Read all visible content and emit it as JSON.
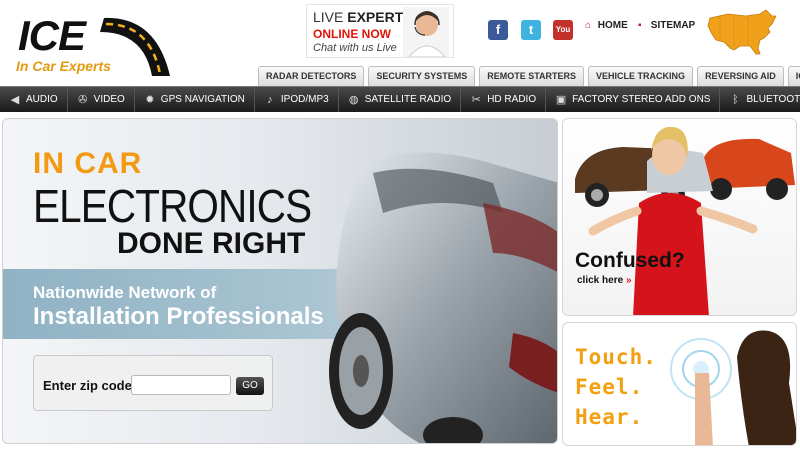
{
  "logo": {
    "name": "ICE",
    "tagline": "In Car Experts"
  },
  "live_expert": {
    "line1_prefix": "LIVE",
    "line1_bold": "EXPERT",
    "line2": "ONLINE NOW",
    "line3": "Chat with us Live"
  },
  "social": {
    "facebook_glyph": "f",
    "twitter_glyph": "t",
    "youtube_glyph": "You Tube"
  },
  "top_links": {
    "home": "HOME",
    "sitemap": "SITEMAP"
  },
  "tabs": [
    "RADAR DETECTORS",
    "SECURITY SYSTEMS",
    "REMOTE STARTERS",
    "VEHICLE TRACKING",
    "REVERSING AID",
    "ICE BLOG"
  ],
  "nav": [
    {
      "label": "AUDIO",
      "icon": "speaker-icon"
    },
    {
      "label": "VIDEO",
      "icon": "film-reel-icon"
    },
    {
      "label": "GPS NAVIGATION",
      "icon": "gear-icon"
    },
    {
      "label": "IPOD/MP3",
      "icon": "music-note-icon"
    },
    {
      "label": "SATELLITE RADIO",
      "icon": "satellite-icon"
    },
    {
      "label": "HD RADIO",
      "icon": "tools-icon"
    },
    {
      "label": "FACTORY STEREO ADD ONS",
      "icon": "radio-icon"
    },
    {
      "label": "BLUETOOTH",
      "icon": "bluetooth-icon"
    }
  ],
  "banner": {
    "headline1": "IN CAR",
    "headline2": "ELECTRONICS",
    "headline3": "DONE RIGHT",
    "network1": "Nationwide Network of",
    "network2": "Installation Professionals",
    "zip_label": "Enter zip code",
    "zip_value": "",
    "go_label": "GO"
  },
  "confused_panel": {
    "question": "Confused?",
    "click_text": "click here",
    "click_arrows": "»"
  },
  "touch_panel": {
    "line1": "Touch.",
    "line2": "Feel.",
    "line3": "Hear."
  },
  "colors": {
    "accent_orange": "#f39a15",
    "link_red": "#e2130b",
    "nav_dark": "#1a1a1a"
  }
}
